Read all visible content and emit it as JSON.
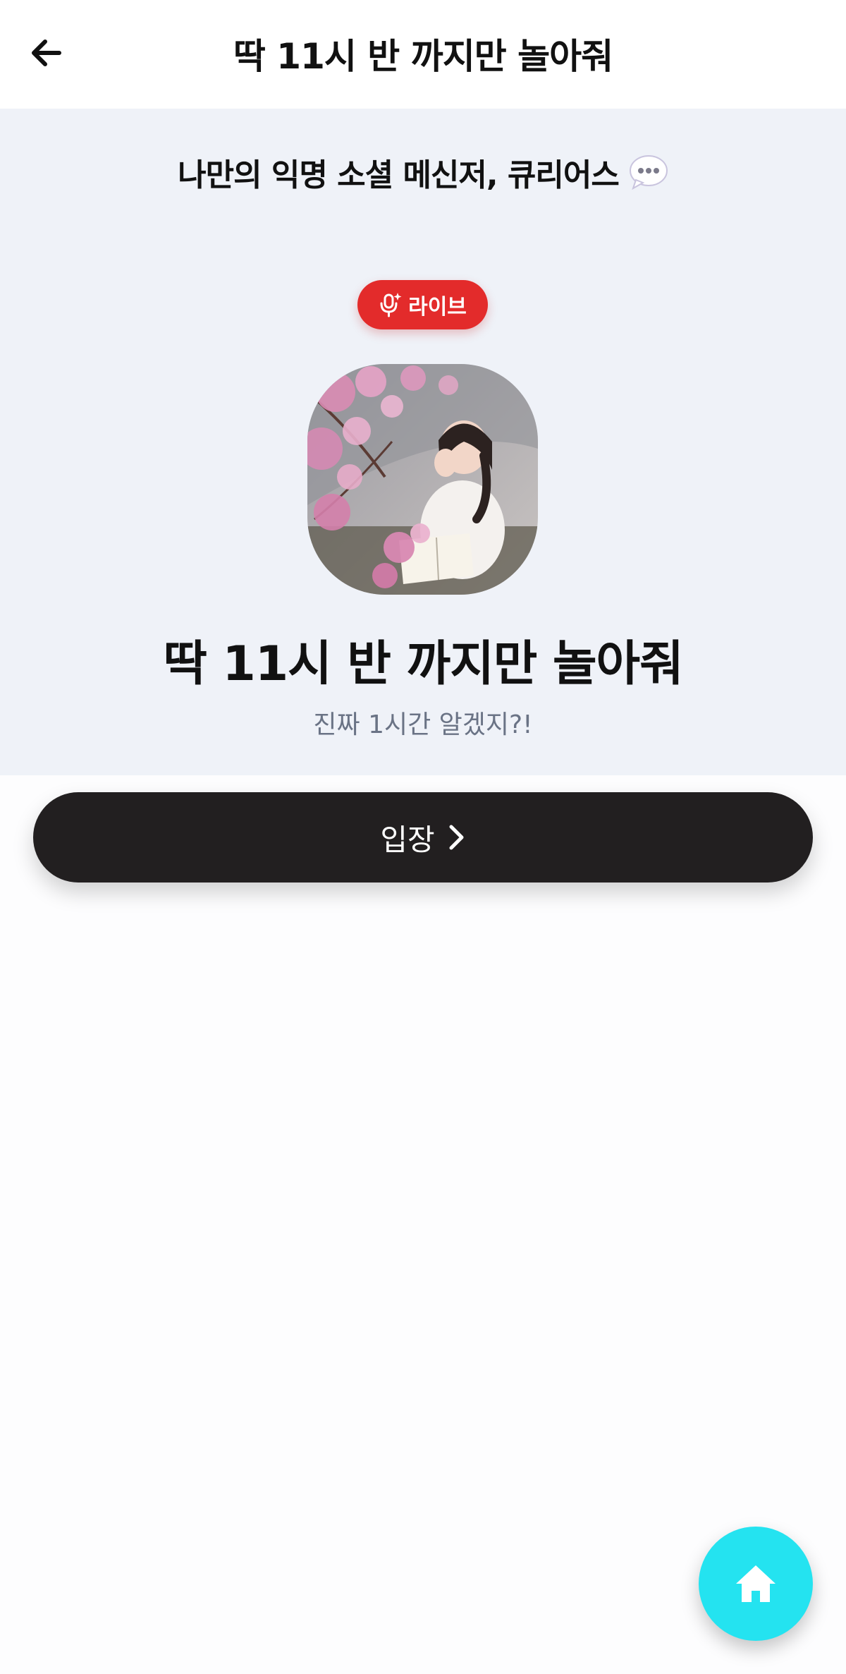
{
  "header": {
    "title": "딱 11시 반 까지만 놀아줘",
    "back_icon": "arrow-left-icon"
  },
  "hero": {
    "promo_text": "나만의 익명 소셜 메신저, 큐리어스",
    "promo_icon": "speech-bubble-icon",
    "live_badge": {
      "label": "라이브",
      "icon": "microphone-sparkle-icon",
      "color": "#e32b2b"
    },
    "avatar_alt": "profile photo",
    "room_title": "딱 11시 반 까지만 놀아줘",
    "room_subtitle": "진짜 1시간 알겠지?!",
    "background": "#eff2f8"
  },
  "enter_button": {
    "label": "입장",
    "icon": "chevron-right-icon",
    "color": "#221f20"
  },
  "home_button": {
    "icon": "home-icon",
    "color": "#24e3f0"
  }
}
